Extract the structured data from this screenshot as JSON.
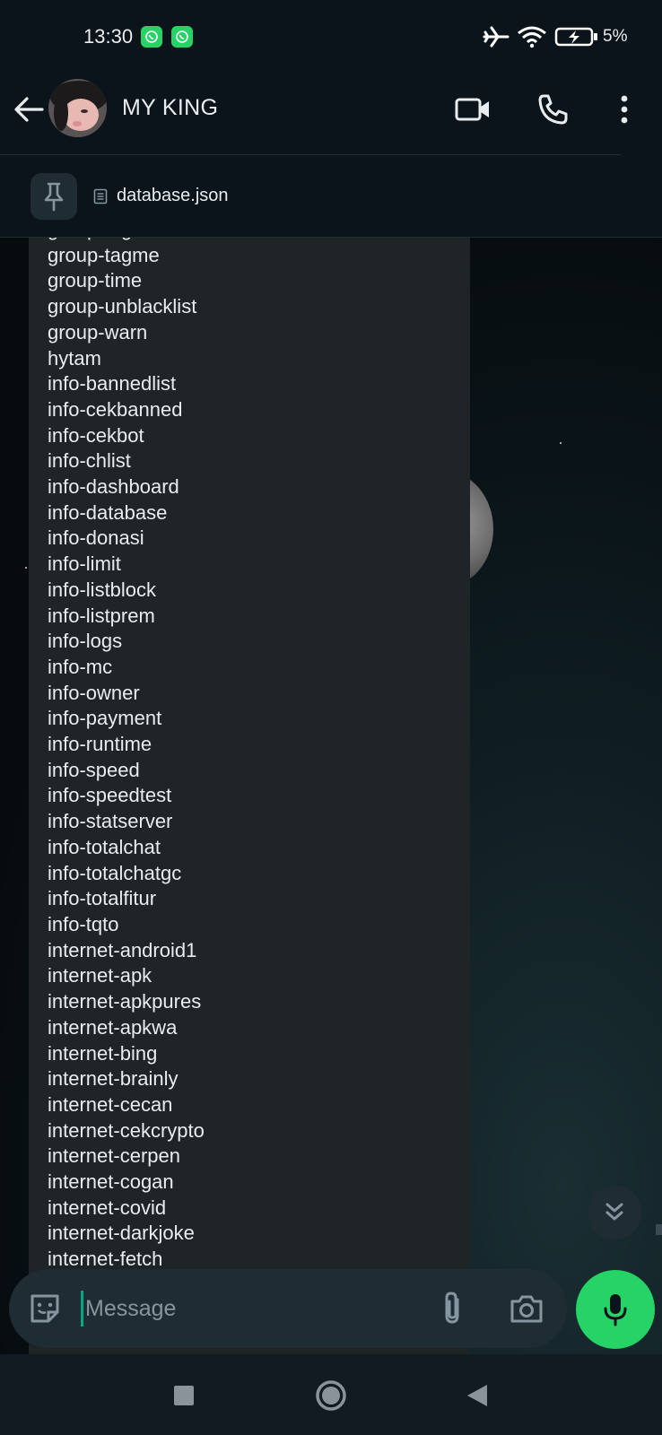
{
  "status_bar": {
    "time": "13:30",
    "notification_icons": [
      "whatsapp-icon",
      "whatsapp-icon"
    ],
    "system_icons": [
      "airplane-mode-icon",
      "wifi-icon",
      "battery-charging-icon"
    ],
    "battery": "5%"
  },
  "header": {
    "contact_name": "MY KING",
    "actions": [
      "video-call-icon",
      "phone-call-icon",
      "more-options-icon"
    ]
  },
  "pinned": {
    "file_name": "database.json"
  },
  "message": {
    "lines": [
      "group-tagall",
      "group-tagme",
      "group-time",
      "group-unblacklist",
      "group-warn",
      "hytam",
      "info-bannedlist",
      "info-cekbanned",
      "info-cekbot",
      "info-chlist",
      "info-dashboard",
      "info-database",
      "info-donasi",
      "info-limit",
      "info-listblock",
      "info-listprem",
      "info-logs",
      "info-mc",
      "info-owner",
      "info-payment",
      "info-runtime",
      "info-speed",
      "info-speedtest",
      "info-statserver",
      "info-totalchat",
      "info-totalchatgc",
      "info-totalfitur",
      "info-tqto",
      "internet-android1",
      "internet-apk",
      "internet-apkpures",
      "internet-apkwa",
      "internet-bing",
      "internet-brainly",
      "internet-cecan",
      "internet-cekcrypto",
      "internet-cerpen",
      "internet-cogan",
      "internet-covid",
      "internet-darkjoke",
      "internet-fetch"
    ]
  },
  "input": {
    "placeholder": "Message"
  },
  "colors": {
    "accent": "#25d366",
    "background": "#0b141a",
    "bubble": "#1f2426"
  }
}
